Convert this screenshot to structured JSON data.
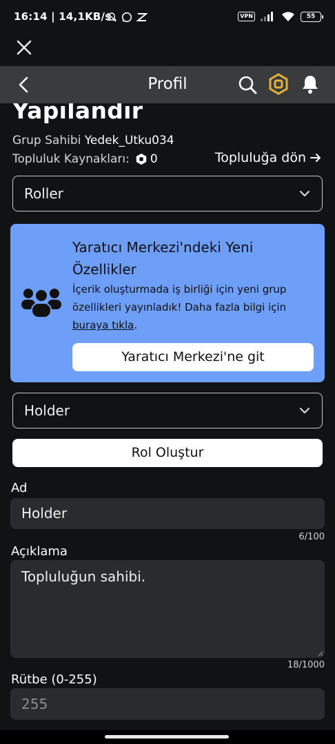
{
  "status_bar": {
    "time_network": "16:14 | 14,1KB/s",
    "vpn": "VPN",
    "battery": "55"
  },
  "nav": {
    "title": "Profil"
  },
  "page": {
    "title": "Yapılandır",
    "owner_label": "Grup Sahibi",
    "owner_name": "Yedek_Utku034",
    "funds_label": "Topluluk Kaynakları:",
    "funds_value": "0",
    "back_to_group": "Topluluğa dön"
  },
  "section_dropdown": {
    "selected": "Roller"
  },
  "promo": {
    "title": "Yaratıcı Merkezi'ndeki Yeni Özellikler",
    "body": "İçerik oluşturmada iş birliği için yeni grup özellikleri yayınladık! Daha fazla bilgi için",
    "link": "buraya tıkla",
    "link_suffix": ".",
    "button": "Yaratıcı Merkezi'ne git"
  },
  "role_dropdown": {
    "selected": "Holder"
  },
  "create_role_button": "Rol Oluştur",
  "form": {
    "name_label": "Ad",
    "name_value": "Holder",
    "name_counter": "6/100",
    "description_label": "Açıklama",
    "description_value": "Topluluğun sahibi.",
    "description_counter": "18/1000",
    "rank_label": "Rütbe (0-255)",
    "rank_value": "255"
  },
  "colors": {
    "background": "#111214",
    "navbar": "#393b3d",
    "promo": "#6e9ff8",
    "field": "#2a2b2e",
    "robux_gold": "#e3b23c"
  }
}
